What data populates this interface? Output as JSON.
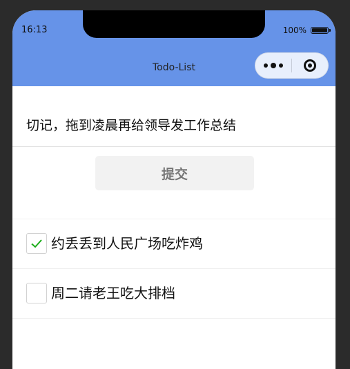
{
  "status_bar": {
    "time": "16:13",
    "battery_percent": "100%"
  },
  "nav": {
    "title": "Todo-List",
    "capsule_more_icon": "more-dots-icon",
    "capsule_close_icon": "target-circle-icon"
  },
  "form": {
    "input_value": "切记，拖到凌晨再给领导发工作总结",
    "submit_label": "提交"
  },
  "todos": [
    {
      "label": "约丢丢到人民广场吃炸鸡",
      "checked": true
    },
    {
      "label": "周二请老王吃大排档",
      "checked": false
    }
  ],
  "colors": {
    "header_bg": "#6693e8",
    "check_green": "#1aad19",
    "submit_bg": "#f2f2f2"
  }
}
